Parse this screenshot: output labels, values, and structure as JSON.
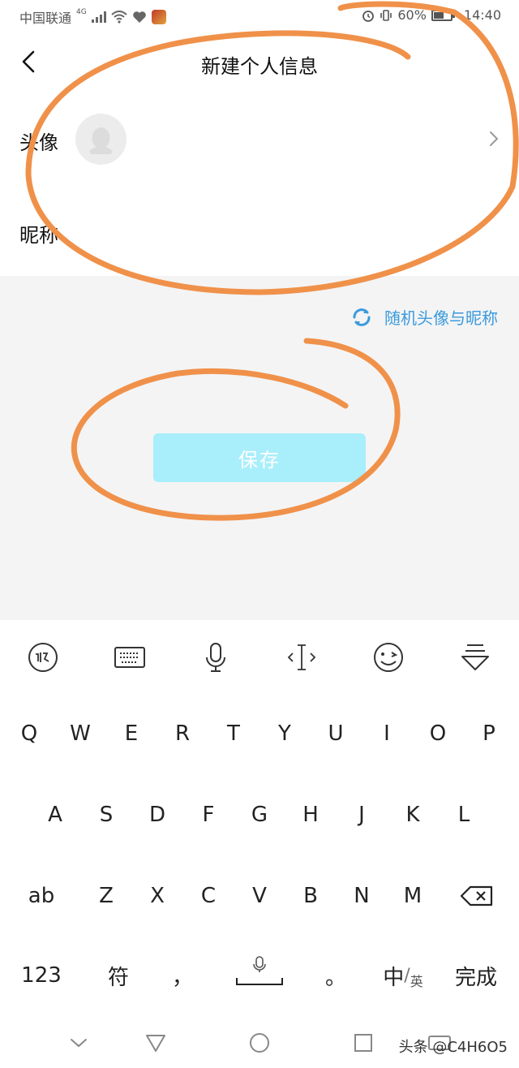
{
  "status_bar": {
    "carrier": "中国联通",
    "network": "4G",
    "battery": "60%",
    "battery_level": 0.6,
    "time": "14:40"
  },
  "header": {
    "title": "新建个人信息",
    "back_icon": "chevron-left-icon"
  },
  "form": {
    "avatar_label": "头像",
    "nickname_label": "昵称"
  },
  "actions": {
    "random_label": "随机头像与昵称",
    "save_label": "保存"
  },
  "colors": {
    "accent": "#3a9bdc",
    "save_button": "#a9eefb",
    "annotation": "#f0914a"
  },
  "keyboard": {
    "toolbar_icons": [
      "xunfei-icon",
      "keyboard-icon",
      "microphone-icon",
      "cursor-icon",
      "emoji-icon",
      "collapse-keyboard-icon"
    ],
    "row1": [
      "Q",
      "W",
      "E",
      "R",
      "T",
      "Y",
      "U",
      "I",
      "O",
      "P"
    ],
    "row2": [
      "A",
      "S",
      "D",
      "F",
      "G",
      "H",
      "J",
      "K",
      "L"
    ],
    "row3_left": "ab",
    "row3": [
      "Z",
      "X",
      "C",
      "V",
      "B",
      "N",
      "M"
    ],
    "bottom": {
      "num": "123",
      "symbol": "符",
      "comma": "，",
      "period": "。",
      "lang_main": "中",
      "lang_sep": "/",
      "lang_sub": "英",
      "done": "完成"
    }
  },
  "navigation": {
    "icons": [
      "hide-icon",
      "back-triangle-icon",
      "home-circle-icon",
      "recents-square-icon",
      "keyboard-switch-icon"
    ]
  },
  "watermark": "头条 @C4H6O5"
}
